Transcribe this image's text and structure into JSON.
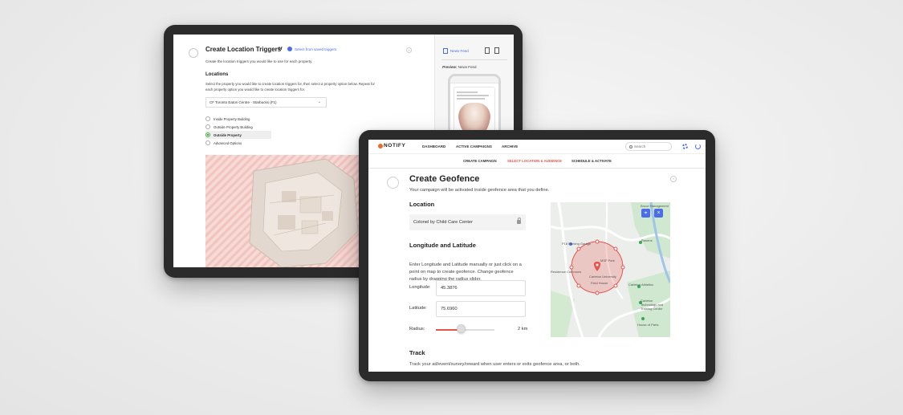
{
  "back": {
    "title": "Create Location Triggers",
    "or_label": "or",
    "select_saved": "Select from saved triggers",
    "subtitle": "Create the location triggers you would like to use for each property.",
    "locations_heading": "Locations",
    "locations_desc": "Select the property you would like to create location triggers for, then select a property option below. Repeat for each property option you would like to create location triggers for.",
    "property_select": "CF Toronto Eaton Centre - Starbucks (F1)",
    "radio_options": [
      {
        "label": "Inside Property Building",
        "selected": false
      },
      {
        "label": "Outside Property Building",
        "selected": false
      },
      {
        "label": "Outside Property",
        "selected": true
      },
      {
        "label": "Advanced Options",
        "selected": false
      }
    ],
    "sidebar": {
      "news_feed": "News Feed",
      "preview_label": "Preview:",
      "preview_value": "News Feed"
    }
  },
  "front": {
    "logo": "NOTIFY",
    "nav": [
      "DASHBOARD",
      "ACTIVE CAMPAIGNS",
      "ARCHIVE"
    ],
    "search_placeholder": "Search",
    "subnav": [
      {
        "label": "CREATE CAMPAIGN",
        "active": false
      },
      {
        "label": "SELECT LOCATION & AUDIENCE",
        "active": true
      },
      {
        "label": "SCHEDULE & ACTIVATE",
        "active": false
      }
    ],
    "title": "Create Geofence",
    "subtitle": "Your campaign will be activated inside geofence area that you define.",
    "location_heading": "Location",
    "location_value": "Colonel by Child Care Center",
    "lonlat_heading": "Longitude and Latitude",
    "lonlat_desc": "Enter Longitude and Latitude manually or just click on a point on map to create geofence. Change geofence radius by dragging the radius slider.",
    "longitude_label": "Longitude:",
    "longitude_value": "45.3876",
    "latitude_label": "Latitude:",
    "latitude_value": "75.6960",
    "radius_label": "Radius:",
    "radius_value": "2 km",
    "radius_level": 0.42,
    "track_heading": "Track",
    "track_desc": "Track your ad/event/survey/reward when user enters or exits geofence area, or both.",
    "map": {
      "labels": [
        "Bruce Management",
        "P18 Parking Garage",
        "Ravens",
        "Residence Commons",
        "MSF Park",
        "Carleton University",
        "Field House",
        "Carleton Athletics",
        "Carleton Technology and Training Centre",
        "House of Parts"
      ]
    },
    "accent": "#e8534d",
    "brand_blue": "#4b6ee8"
  }
}
